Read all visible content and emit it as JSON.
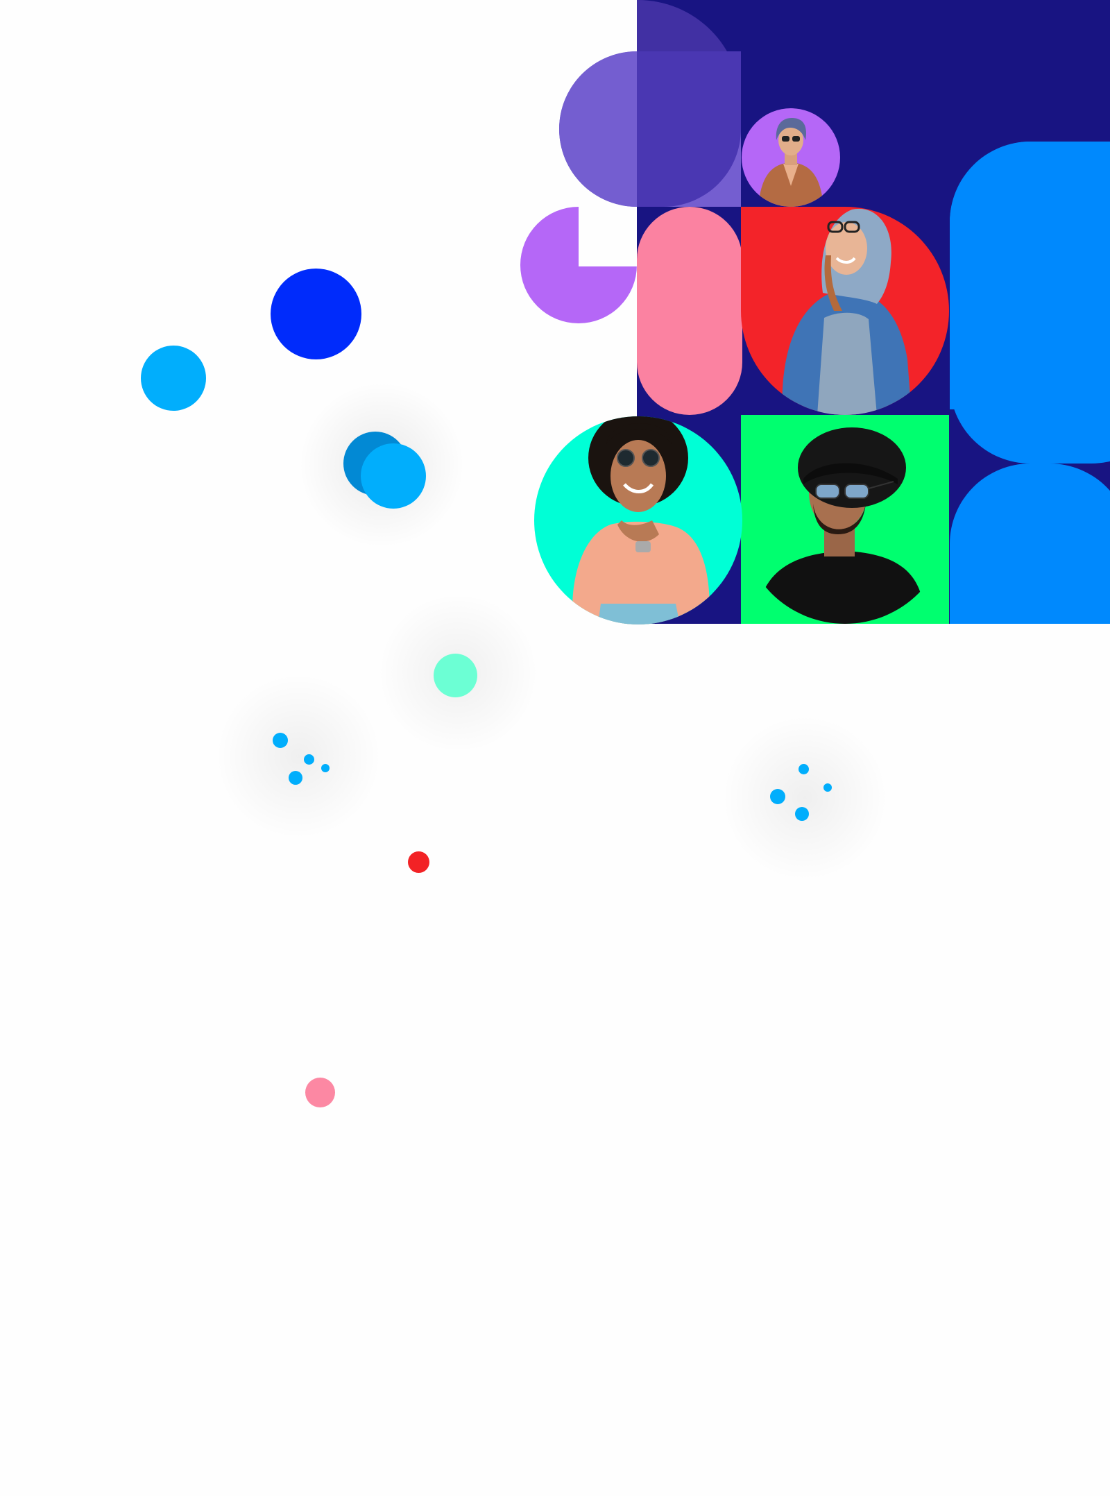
{
  "colors": {
    "background": "#fefefe",
    "navy": "#181482",
    "violet_dark": "#4130a3",
    "violet_light": "#745ed0",
    "purple": "#b567f7",
    "pink": "#fb82a1",
    "red": "#f32329",
    "green": "#00ff6f",
    "aqua": "#00ffd6",
    "bright_blue": "#0089fd",
    "cobalt": "#002bfb",
    "sky": "#01aefc",
    "sky_dark": "#0289d4",
    "mint": "#6cffd4",
    "dot_red": "#f22225",
    "dot_pink": "#fc88a3"
  },
  "illustration": {
    "people": [
      {
        "name": "person-woman-in-coat",
        "icon": "portrait-icon"
      },
      {
        "name": "person-woman-in-hoodie",
        "icon": "portrait-icon"
      },
      {
        "name": "person-woman-curly-hair",
        "icon": "portrait-icon"
      },
      {
        "name": "person-man-in-hat",
        "icon": "portrait-icon"
      }
    ]
  }
}
